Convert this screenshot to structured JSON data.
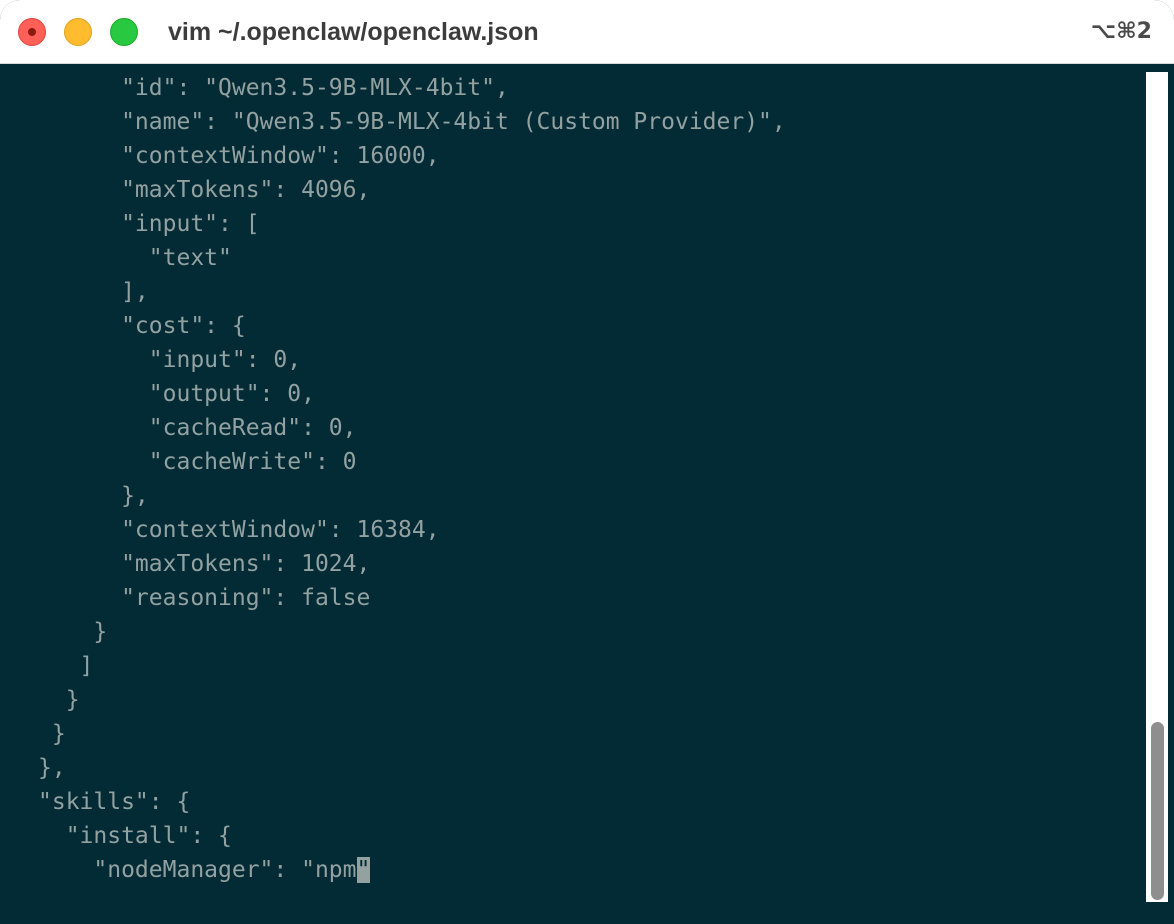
{
  "window": {
    "title": "vim ~/.openclaw/openclaw.json",
    "shortcut": "⌥⌘2"
  },
  "editor": {
    "lines": [
      "      \"id\": \"Qwen3.5-9B-MLX-4bit\",",
      "      \"name\": \"Qwen3.5-9B-MLX-4bit (Custom Provider)\",",
      "      \"contextWindow\": 16000,",
      "      \"maxTokens\": 4096,",
      "      \"input\": [",
      "        \"text\"",
      "      ],",
      "      \"cost\": {",
      "        \"input\": 0,",
      "        \"output\": 0,",
      "        \"cacheRead\": 0,",
      "        \"cacheWrite\": 0",
      "      },",
      "      \"contextWindow\": 16384,",
      "      \"maxTokens\": 1024,",
      "      \"reasoning\": false",
      "    }",
      "   ]",
      "  }",
      " }",
      "},",
      "\"skills\": {",
      "  \"install\": {"
    ],
    "last_line_before_cursor": "    \"nodeManager\": \"npm",
    "cursor_char": "\""
  }
}
